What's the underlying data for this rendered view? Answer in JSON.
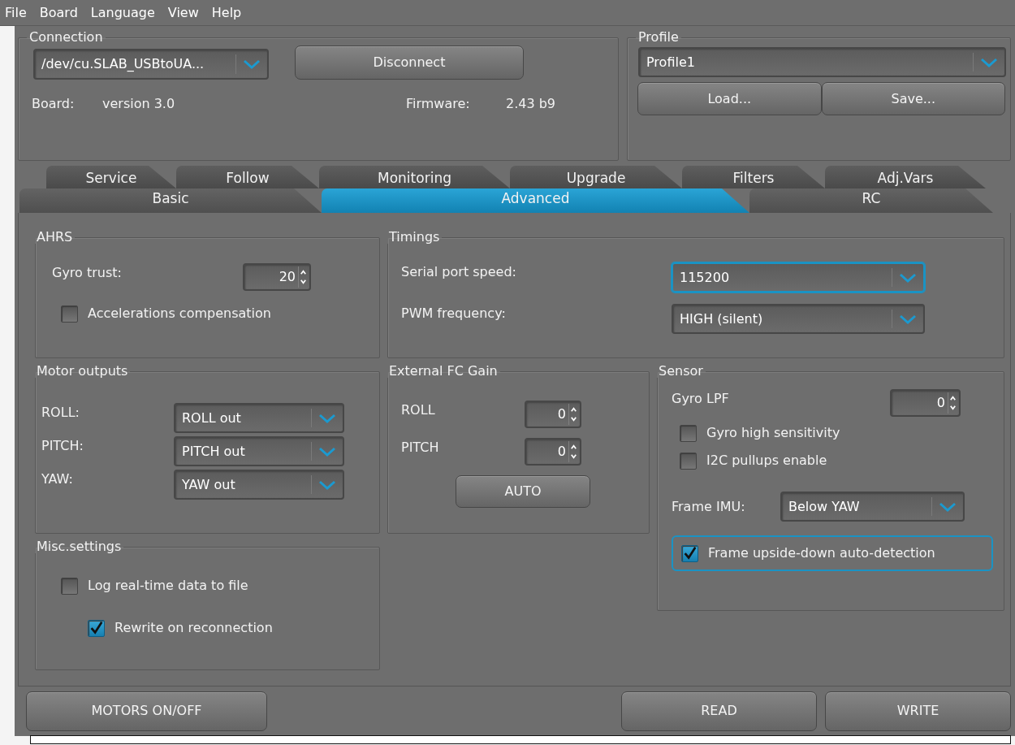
{
  "menu": [
    "File",
    "Board",
    "Language",
    "View",
    "Help"
  ],
  "connection": {
    "title": "Connection",
    "port": {
      "value": "/dev/cu.SLAB_USBtoUA..."
    },
    "button": "Disconnect",
    "board_label": "Board:",
    "board_value": "version 3.0",
    "firmware_label": "Firmware:",
    "firmware_value": "2.43 b9"
  },
  "profile": {
    "title": "Profile",
    "select": {
      "value": "Profile1"
    },
    "buttons": [
      "Load...",
      "Save..."
    ]
  },
  "tabs": [
    [
      {
        "label": "Service",
        "selected": false
      },
      {
        "label": "Follow",
        "selected": false
      },
      {
        "label": "Monitoring",
        "selected": false
      },
      {
        "label": "Upgrade",
        "selected": false
      },
      {
        "label": "Filters",
        "selected": false
      },
      {
        "label": "Adj.Vars",
        "selected": false
      }
    ],
    [
      {
        "label": "Basic",
        "selected": false
      },
      {
        "label": "Advanced",
        "selected": true
      },
      {
        "label": "RC",
        "selected": false
      }
    ]
  ],
  "panels": [
    {
      "title": "AHRS",
      "rows": [
        {
          "kind": "spinner",
          "label": "Gyro trust:",
          "value": "20"
        },
        {
          "kind": "checkbox",
          "label": "Accelerations compensation",
          "checked": false,
          "focused": false
        }
      ]
    },
    {
      "title": "Timings",
      "rows": [
        {
          "kind": "select",
          "label": "Serial port speed:",
          "value": "115200",
          "focused": true
        },
        {
          "kind": "select",
          "label": "PWM frequency:",
          "value": "HIGH (silent)",
          "focused": false
        }
      ]
    },
    {
      "title": "Motor outputs",
      "rows": [
        {
          "kind": "select",
          "label": "ROLL:",
          "value": "ROLL out",
          "focused": false
        },
        {
          "kind": "select",
          "label": "PITCH:",
          "value": "PITCH out",
          "focused": false
        },
        {
          "kind": "select",
          "label": "YAW:",
          "value": "YAW out",
          "focused": false
        }
      ]
    },
    {
      "title": "External FC Gain",
      "rows": [
        {
          "kind": "spinner",
          "label": "ROLL",
          "value": "0"
        },
        {
          "kind": "spinner",
          "label": "PITCH",
          "value": "0"
        },
        {
          "kind": "button",
          "label": "AUTO"
        }
      ]
    },
    {
      "title": "Sensor",
      "rows": [
        {
          "kind": "spinner",
          "label": "Gyro LPF",
          "value": "0"
        },
        {
          "kind": "checkbox",
          "label": "Gyro high sensitivity",
          "checked": false,
          "focused": false
        },
        {
          "kind": "checkbox",
          "label": "I2C pullups enable",
          "checked": false,
          "focused": false
        },
        {
          "kind": "select",
          "label": "Frame IMU:",
          "value": "Below YAW",
          "focused": false
        },
        {
          "kind": "checkbox",
          "label": "Frame upside-down auto-detection",
          "checked": true,
          "focused": true
        }
      ]
    },
    {
      "title": "Misc.settings",
      "rows": [
        {
          "kind": "checkbox",
          "label": "Log real-time data to file",
          "checked": false,
          "focused": false,
          "children": [
            {
              "kind": "checkbox",
              "label": "Rewrite on reconnection",
              "checked": true,
              "focused": false
            }
          ]
        }
      ]
    }
  ],
  "bottom_buttons": {
    "left": [
      "MOTORS ON/OFF"
    ],
    "right": [
      "READ",
      "WRITE"
    ]
  }
}
